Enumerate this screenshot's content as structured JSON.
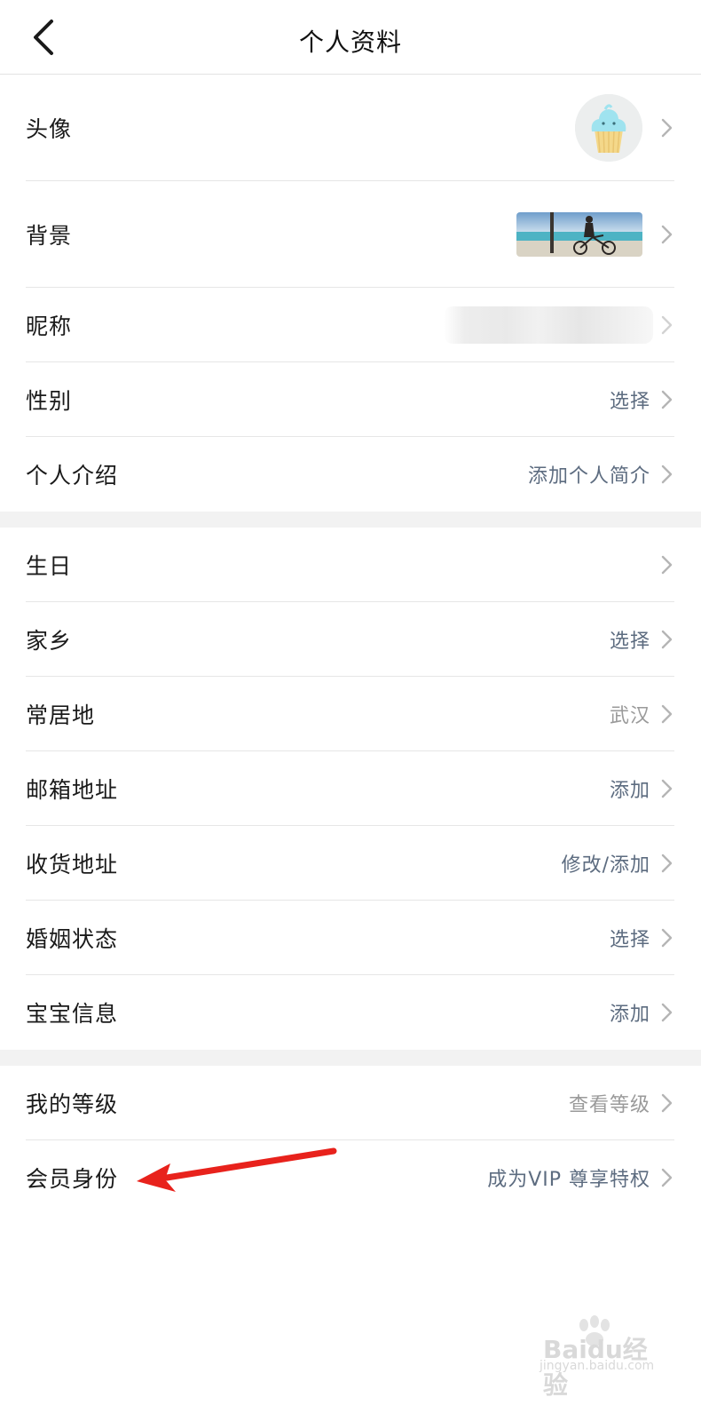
{
  "header": {
    "title": "个人资料"
  },
  "section1": [
    {
      "label": "头像",
      "type": "avatar"
    },
    {
      "label": "背景",
      "type": "background"
    },
    {
      "label": "昵称",
      "type": "nickname"
    },
    {
      "label": "性别",
      "value": "选择"
    },
    {
      "label": "个人介绍",
      "value": "添加个人简介"
    }
  ],
  "section2": [
    {
      "label": "生日",
      "value": ""
    },
    {
      "label": "家乡",
      "value": "选择"
    },
    {
      "label": "常居地",
      "value": "武汉"
    },
    {
      "label": "邮箱地址",
      "value": "添加"
    },
    {
      "label": "收货地址",
      "value": "修改/添加"
    },
    {
      "label": "婚姻状态",
      "value": "选择"
    },
    {
      "label": "宝宝信息",
      "value": "添加"
    }
  ],
  "section3": [
    {
      "label": "我的等级",
      "value": "查看等级"
    },
    {
      "label": "会员身份",
      "value": "成为VIP 尊享特权"
    }
  ],
  "colors": {
    "value_blue": "#5d6c80",
    "value_grey": "#9a9a9a",
    "annotation_red": "#e8221c",
    "section_gap": "#f2f2f2"
  },
  "icons": {
    "back": "chevron-left-icon",
    "row_arrow": "chevron-right-icon",
    "avatar": "cupcake-icon",
    "annotation": "red-arrow"
  },
  "watermark": {
    "brand": "Baidu经验",
    "url": "jingyan.baidu.com"
  }
}
